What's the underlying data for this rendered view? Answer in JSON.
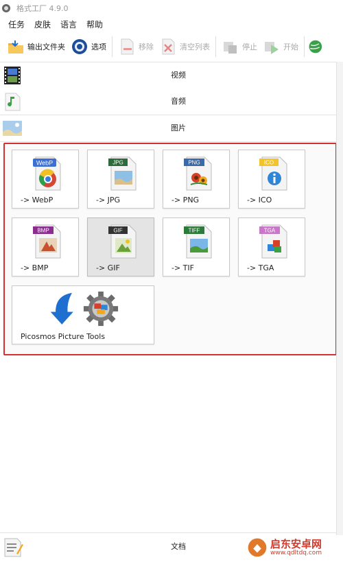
{
  "window": {
    "title": "格式工厂 4.9.0"
  },
  "menu": [
    "任务",
    "皮肤",
    "语言",
    "帮助"
  ],
  "toolbar": {
    "output_folder": "输出文件夹",
    "options": "选项",
    "remove": "移除",
    "clear_list": "清空列表",
    "stop": "停止",
    "start": "开始"
  },
  "categories": {
    "video": "视频",
    "audio": "音频",
    "picture": "图片",
    "document": "文档"
  },
  "tiles": [
    {
      "badge": "WebP",
      "label": "-> WebP",
      "badge_color": "#3b6fd4"
    },
    {
      "badge": "JPG",
      "label": "-> JPG",
      "badge_color": "#2c6b3a"
    },
    {
      "badge": "PNG",
      "label": "-> PNG",
      "badge_color": "#3a6aa8"
    },
    {
      "badge": "ICO",
      "label": "-> ICO",
      "badge_color": "#f3c32a"
    },
    {
      "badge": "BMP",
      "label": "-> BMP",
      "badge_color": "#8b2f8f"
    },
    {
      "badge": "GIF",
      "label": "-> GIF",
      "badge_color": "#333333"
    },
    {
      "badge": "TIFF",
      "label": "-> TIF",
      "badge_color": "#2d7a3a"
    },
    {
      "badge": "TGA",
      "label": "-> TGA",
      "badge_color": "#c978c8"
    },
    {
      "label": "Picosmos Picture Tools"
    }
  ],
  "selected_tile": "-> GIF",
  "watermark": {
    "name": "启东安卓网",
    "url": "www.qdltdq.com"
  },
  "colors": {
    "highlight_border": "#d62f2f",
    "accent": "#d03a2c"
  }
}
